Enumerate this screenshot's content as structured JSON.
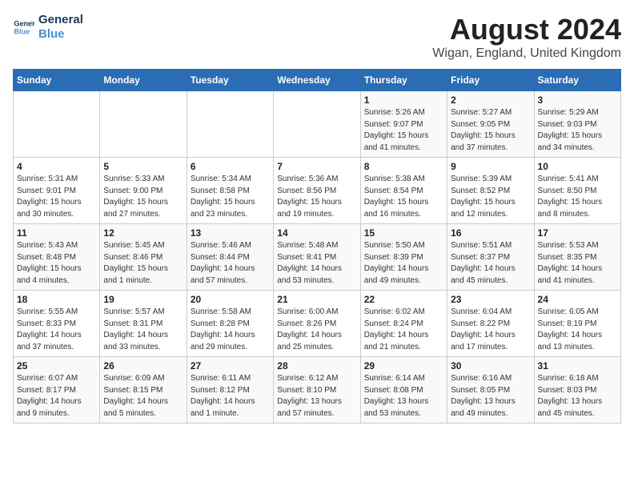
{
  "header": {
    "logo_line1": "General",
    "logo_line2": "Blue",
    "title": "August 2024",
    "subtitle": "Wigan, England, United Kingdom"
  },
  "weekdays": [
    "Sunday",
    "Monday",
    "Tuesday",
    "Wednesday",
    "Thursday",
    "Friday",
    "Saturday"
  ],
  "weeks": [
    [
      {
        "day": "",
        "info": ""
      },
      {
        "day": "",
        "info": ""
      },
      {
        "day": "",
        "info": ""
      },
      {
        "day": "",
        "info": ""
      },
      {
        "day": "1",
        "info": "Sunrise: 5:26 AM\nSunset: 9:07 PM\nDaylight: 15 hours\nand 41 minutes."
      },
      {
        "day": "2",
        "info": "Sunrise: 5:27 AM\nSunset: 9:05 PM\nDaylight: 15 hours\nand 37 minutes."
      },
      {
        "day": "3",
        "info": "Sunrise: 5:29 AM\nSunset: 9:03 PM\nDaylight: 15 hours\nand 34 minutes."
      }
    ],
    [
      {
        "day": "4",
        "info": "Sunrise: 5:31 AM\nSunset: 9:01 PM\nDaylight: 15 hours\nand 30 minutes."
      },
      {
        "day": "5",
        "info": "Sunrise: 5:33 AM\nSunset: 9:00 PM\nDaylight: 15 hours\nand 27 minutes."
      },
      {
        "day": "6",
        "info": "Sunrise: 5:34 AM\nSunset: 8:58 PM\nDaylight: 15 hours\nand 23 minutes."
      },
      {
        "day": "7",
        "info": "Sunrise: 5:36 AM\nSunset: 8:56 PM\nDaylight: 15 hours\nand 19 minutes."
      },
      {
        "day": "8",
        "info": "Sunrise: 5:38 AM\nSunset: 8:54 PM\nDaylight: 15 hours\nand 16 minutes."
      },
      {
        "day": "9",
        "info": "Sunrise: 5:39 AM\nSunset: 8:52 PM\nDaylight: 15 hours\nand 12 minutes."
      },
      {
        "day": "10",
        "info": "Sunrise: 5:41 AM\nSunset: 8:50 PM\nDaylight: 15 hours\nand 8 minutes."
      }
    ],
    [
      {
        "day": "11",
        "info": "Sunrise: 5:43 AM\nSunset: 8:48 PM\nDaylight: 15 hours\nand 4 minutes."
      },
      {
        "day": "12",
        "info": "Sunrise: 5:45 AM\nSunset: 8:46 PM\nDaylight: 15 hours\nand 1 minute."
      },
      {
        "day": "13",
        "info": "Sunrise: 5:46 AM\nSunset: 8:44 PM\nDaylight: 14 hours\nand 57 minutes."
      },
      {
        "day": "14",
        "info": "Sunrise: 5:48 AM\nSunset: 8:41 PM\nDaylight: 14 hours\nand 53 minutes."
      },
      {
        "day": "15",
        "info": "Sunrise: 5:50 AM\nSunset: 8:39 PM\nDaylight: 14 hours\nand 49 minutes."
      },
      {
        "day": "16",
        "info": "Sunrise: 5:51 AM\nSunset: 8:37 PM\nDaylight: 14 hours\nand 45 minutes."
      },
      {
        "day": "17",
        "info": "Sunrise: 5:53 AM\nSunset: 8:35 PM\nDaylight: 14 hours\nand 41 minutes."
      }
    ],
    [
      {
        "day": "18",
        "info": "Sunrise: 5:55 AM\nSunset: 8:33 PM\nDaylight: 14 hours\nand 37 minutes."
      },
      {
        "day": "19",
        "info": "Sunrise: 5:57 AM\nSunset: 8:31 PM\nDaylight: 14 hours\nand 33 minutes."
      },
      {
        "day": "20",
        "info": "Sunrise: 5:58 AM\nSunset: 8:28 PM\nDaylight: 14 hours\nand 29 minutes."
      },
      {
        "day": "21",
        "info": "Sunrise: 6:00 AM\nSunset: 8:26 PM\nDaylight: 14 hours\nand 25 minutes."
      },
      {
        "day": "22",
        "info": "Sunrise: 6:02 AM\nSunset: 8:24 PM\nDaylight: 14 hours\nand 21 minutes."
      },
      {
        "day": "23",
        "info": "Sunrise: 6:04 AM\nSunset: 8:22 PM\nDaylight: 14 hours\nand 17 minutes."
      },
      {
        "day": "24",
        "info": "Sunrise: 6:05 AM\nSunset: 8:19 PM\nDaylight: 14 hours\nand 13 minutes."
      }
    ],
    [
      {
        "day": "25",
        "info": "Sunrise: 6:07 AM\nSunset: 8:17 PM\nDaylight: 14 hours\nand 9 minutes."
      },
      {
        "day": "26",
        "info": "Sunrise: 6:09 AM\nSunset: 8:15 PM\nDaylight: 14 hours\nand 5 minutes."
      },
      {
        "day": "27",
        "info": "Sunrise: 6:11 AM\nSunset: 8:12 PM\nDaylight: 14 hours\nand 1 minute."
      },
      {
        "day": "28",
        "info": "Sunrise: 6:12 AM\nSunset: 8:10 PM\nDaylight: 13 hours\nand 57 minutes."
      },
      {
        "day": "29",
        "info": "Sunrise: 6:14 AM\nSunset: 8:08 PM\nDaylight: 13 hours\nand 53 minutes."
      },
      {
        "day": "30",
        "info": "Sunrise: 6:16 AM\nSunset: 8:05 PM\nDaylight: 13 hours\nand 49 minutes."
      },
      {
        "day": "31",
        "info": "Sunrise: 6:18 AM\nSunset: 8:03 PM\nDaylight: 13 hours\nand 45 minutes."
      }
    ]
  ]
}
